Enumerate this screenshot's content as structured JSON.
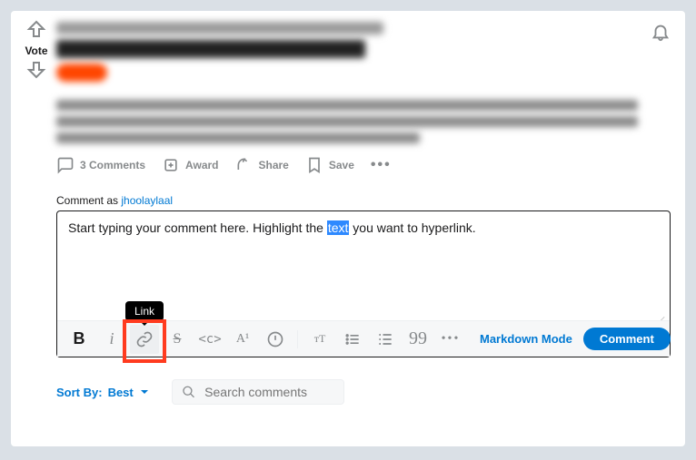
{
  "vote": {
    "label": "Vote"
  },
  "actions": {
    "comments": "3 Comments",
    "award": "Award",
    "share": "Share",
    "save": "Save"
  },
  "comment_as": {
    "prefix": "Comment as ",
    "user": "jhoolaylaal"
  },
  "editor": {
    "text_before": "Start typing your comment here. Highlight the ",
    "text_highlight": "text",
    "text_after": " you want to hyperlink."
  },
  "toolbar": {
    "bold_glyph": "B",
    "italic_glyph": "i",
    "link_tooltip": "Link",
    "strike_glyph": "S",
    "code_glyph": "<c>",
    "superscript_glyph": "A¹",
    "heading_glyph": "тT",
    "quote_glyph": "99",
    "more_glyph": "•••",
    "markdown_label": "Markdown Mode",
    "comment_label": "Comment"
  },
  "sort": {
    "label_prefix": "Sort By: ",
    "label_value": "Best"
  },
  "search": {
    "placeholder": "Search comments"
  }
}
